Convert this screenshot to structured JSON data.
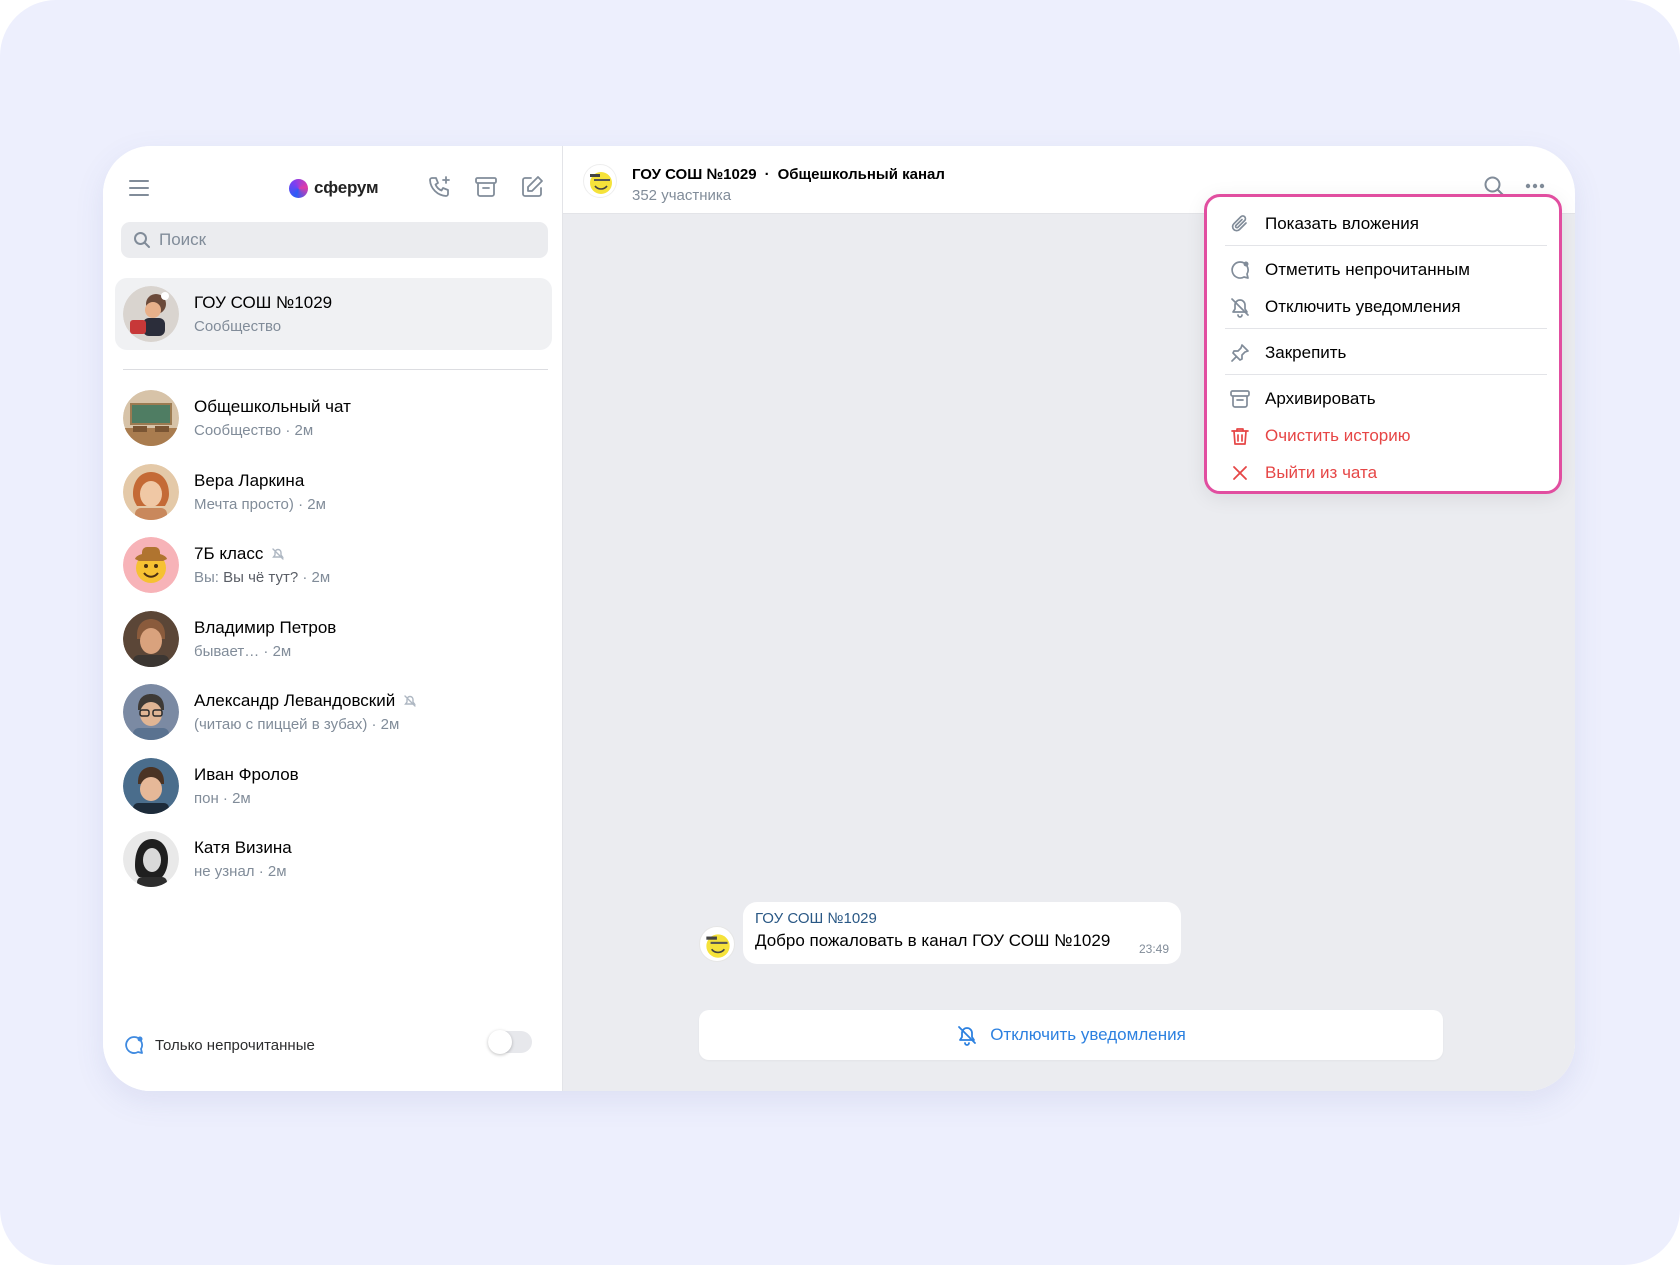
{
  "app": {
    "logo_text": "сферум"
  },
  "sidebar": {
    "search": {
      "placeholder": "Поиск",
      "value": ""
    },
    "active_chat": {
      "title": "ГОУ СОШ №1029",
      "subtitle": "Сообщество"
    },
    "chats": [
      {
        "title": "Общешкольный чат",
        "preview": "Сообщество",
        "time": "2м",
        "muted": false
      },
      {
        "title": "Вера Ларкина",
        "preview": "Мечта просто)",
        "time": "2м",
        "muted": false
      },
      {
        "title": "7Б класс",
        "preview_prefix": "Вы:",
        "preview": "Вы чё тут?",
        "time": "2м",
        "muted": true
      },
      {
        "title": "Владимир Петров",
        "preview": "бывает…",
        "time": "2м",
        "muted": false
      },
      {
        "title": "Александр Левандовский",
        "preview": "(читаю с пиццей в зубах)",
        "time": "2м",
        "muted": true
      },
      {
        "title": "Иван Фролов",
        "preview": "пон",
        "time": "2м",
        "muted": false
      },
      {
        "title": "Катя Визина",
        "preview": "не узнал",
        "time": "2м",
        "muted": false
      }
    ],
    "time_sep": "·",
    "unread_only_label": "Только непрочитанные",
    "unread_only_enabled": false
  },
  "chat": {
    "header": {
      "name": "ГОУ СОШ №1029",
      "separator": "·",
      "channel": "Общешкольный канал",
      "members": "352 участника"
    },
    "message": {
      "author": "ГОУ СОШ №1029",
      "text": "Добро пожаловать в канал ГОУ СОШ №1029",
      "time": "23:49"
    },
    "mute_button_label": "Отключить уведомления"
  },
  "context_menu": {
    "items": [
      {
        "label": "Показать вложения",
        "icon": "paperclip-icon",
        "danger": false
      },
      {
        "label": "Отметить непрочитанным",
        "icon": "unread-bubble-icon",
        "danger": false
      },
      {
        "label": "Отключить уведомления",
        "icon": "bell-off-icon",
        "danger": false
      },
      {
        "label": "Закрепить",
        "icon": "pin-icon",
        "danger": false
      },
      {
        "label": "Архивировать",
        "icon": "archive-icon",
        "danger": false
      },
      {
        "label": "Очистить историю",
        "icon": "trash-icon",
        "danger": true
      },
      {
        "label": "Выйти из чата",
        "icon": "close-icon",
        "danger": true
      }
    ]
  },
  "colors": {
    "accent": "#2d81e0",
    "danger": "#e64646",
    "highlight_border": "#e14ea0",
    "background": "#edeffd"
  }
}
